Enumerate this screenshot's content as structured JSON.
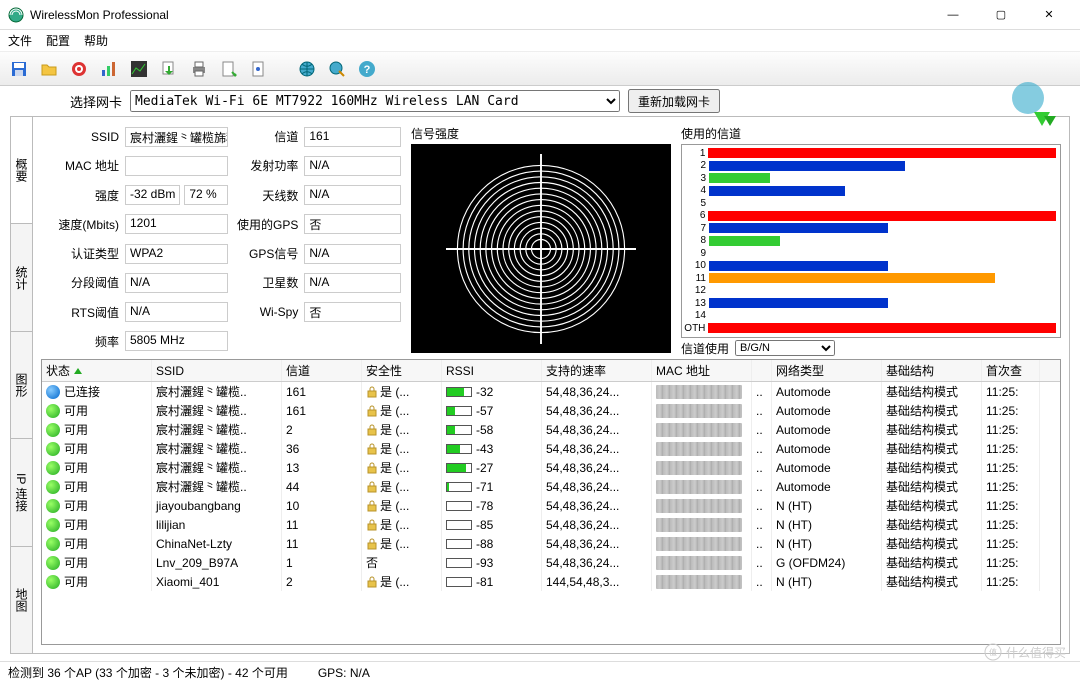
{
  "window": {
    "title": "WirelessMon Professional"
  },
  "menu": {
    "file": "文件",
    "config": "配置",
    "help": "帮助"
  },
  "selector": {
    "label": "选择网卡",
    "card": "MediaTek Wi-Fi 6E MT7922 160MHz Wireless LAN Card",
    "reload": "重新加载网卡"
  },
  "tabs": {
    "t0": "概要",
    "t1": "统计",
    "t2": "图形",
    "t3": "IP 连接",
    "t4": "地图"
  },
  "info": {
    "ssid_l": "SSID",
    "ssid": "宸村灑鍟⺀罐榄旆稃wh",
    "mac_l": "MAC 地址",
    "mac": "",
    "str_l": "强度",
    "str": "-32 dBm",
    "str_pct": "72 %",
    "speed_l": "速度(Mbits)",
    "speed": "1201",
    "auth_l": "认证类型",
    "auth": "WPA2",
    "frag_l": "分段阈值",
    "frag": "N/A",
    "rts_l": "RTS阈值",
    "rts": "N/A",
    "freq_l": "频率",
    "freq": "5805 MHz",
    "chan_l": "信道",
    "chan": "161",
    "tx_l": "发射功率",
    "tx": "N/A",
    "ant_l": "天线数",
    "ant": "N/A",
    "gps_l": "使用的GPS",
    "gps": "否",
    "gpssig_l": "GPS信号",
    "gpssig": "N/A",
    "sat_l": "卫星数",
    "sat": "N/A",
    "wispy_l": "Wi-Spy",
    "wispy": "否"
  },
  "gauge_hdr": "信号强度",
  "chan_hdr": "使用的信道",
  "chan_sel_l": "信道使用",
  "chan_sel_v": "B/G/N",
  "chart_data": {
    "type": "bar",
    "title": "使用的信道",
    "categories": [
      "1",
      "2",
      "3",
      "4",
      "5",
      "6",
      "7",
      "8",
      "9",
      "10",
      "11",
      "12",
      "13",
      "14",
      "OTH"
    ],
    "bars": [
      {
        "ch": "1",
        "color": "red",
        "pct": 100
      },
      {
        "ch": "2",
        "color": "blue",
        "pct": 55
      },
      {
        "ch": "3",
        "color": "green",
        "pct": 17
      },
      {
        "ch": "4",
        "color": "blue",
        "pct": 38
      },
      {
        "ch": "5",
        "color": "",
        "pct": 0
      },
      {
        "ch": "6",
        "color": "red",
        "pct": 100
      },
      {
        "ch": "7",
        "color": "blue",
        "pct": 50
      },
      {
        "ch": "8",
        "color": "green",
        "pct": 20
      },
      {
        "ch": "9",
        "color": "",
        "pct": 0
      },
      {
        "ch": "10",
        "color": "blue",
        "pct": 50
      },
      {
        "ch": "11",
        "color": "orange",
        "pct": 80
      },
      {
        "ch": "12",
        "color": "",
        "pct": 0
      },
      {
        "ch": "13",
        "color": "blue",
        "pct": 50
      },
      {
        "ch": "14",
        "color": "",
        "pct": 0
      },
      {
        "ch": "OTH",
        "color": "red",
        "pct": 100
      }
    ]
  },
  "cols": {
    "status": "状态",
    "ssid": "SSID",
    "chan": "信道",
    "sec": "安全性",
    "rssi": "RSSI",
    "rate": "支持的速率",
    "mac": "MAC 地址",
    "net": "网络类型",
    "infra": "基础结构",
    "first": "首次查"
  },
  "rows": [
    {
      "st": "conn",
      "st_l": "已连接",
      "ssid": "宸村灑鍟⺀罐榄..",
      "ch": "161",
      "sec": "是 (...",
      "rssi": -32,
      "fill": 72,
      "rate": "54,48,36,24...",
      "mac": "",
      "dots": "..",
      "net": "Automode",
      "infra": "基础结构模式",
      "first": "11:25:"
    },
    {
      "st": "avail",
      "st_l": "可用",
      "ssid": "宸村灑鍟⺀罐榄..",
      "ch": "161",
      "sec": "是 (...",
      "rssi": -57,
      "fill": 35,
      "rate": "54,48,36,24...",
      "mac": "",
      "dots": "..",
      "net": "Automode",
      "infra": "基础结构模式",
      "first": "11:25:"
    },
    {
      "st": "avail",
      "st_l": "可用",
      "ssid": "宸村灑鍟⺀罐榄..",
      "ch": "2",
      "sec": "是 (...",
      "rssi": -58,
      "fill": 33,
      "rate": "54,48,36,24...",
      "mac": "",
      "dots": "..",
      "net": "Automode",
      "infra": "基础结构模式",
      "first": "11:25:"
    },
    {
      "st": "avail",
      "st_l": "可用",
      "ssid": "宸村灑鍟⺀罐榄..",
      "ch": "36",
      "sec": "是 (...",
      "rssi": -43,
      "fill": 55,
      "rate": "54,48,36,24...",
      "mac": "",
      "dots": "..",
      "net": "Automode",
      "infra": "基础结构模式",
      "first": "11:25:"
    },
    {
      "st": "avail",
      "st_l": "可用",
      "ssid": "宸村灑鍟⺀罐榄..",
      "ch": "13",
      "sec": "是 (...",
      "rssi": -27,
      "fill": 78,
      "rate": "54,48,36,24...",
      "mac": "",
      "dots": "..",
      "net": "Automode",
      "infra": "基础结构模式",
      "first": "11:25:"
    },
    {
      "st": "avail",
      "st_l": "可用",
      "ssid": "宸村灑鍟⺀罐榄..",
      "ch": "44",
      "sec": "是 (...",
      "rssi": -71,
      "fill": 10,
      "rate": "54,48,36,24...",
      "mac": "",
      "dots": "..",
      "net": "Automode",
      "infra": "基础结构模式",
      "first": "11:25:"
    },
    {
      "st": "avail",
      "st_l": "可用",
      "ssid": "jiayoubangbang",
      "ch": "10",
      "sec": "是 (...",
      "rssi": -78,
      "fill": 3,
      "rate": "54,48,36,24...",
      "mac": "",
      "dots": "..",
      "net": "N (HT)",
      "infra": "基础结构模式",
      "first": "11:25:"
    },
    {
      "st": "avail",
      "st_l": "可用",
      "ssid": "lilijian",
      "ch": "11",
      "sec": "是 (...",
      "rssi": -85,
      "fill": 0,
      "rate": "54,48,36,24...",
      "mac": "",
      "dots": "..",
      "net": "N (HT)",
      "infra": "基础结构模式",
      "first": "11:25:"
    },
    {
      "st": "avail",
      "st_l": "可用",
      "ssid": "ChinaNet-Lzty",
      "ch": "11",
      "sec": "是 (...",
      "rssi": -88,
      "fill": 0,
      "rate": "54,48,36,24...",
      "mac": "",
      "dots": "..",
      "net": "N (HT)",
      "infra": "基础结构模式",
      "first": "11:25:"
    },
    {
      "st": "avail",
      "st_l": "可用",
      "ssid": "Lnv_209_B97A",
      "ch": "1",
      "sec": "否",
      "rssi": -93,
      "fill": 0,
      "rate": "54,48,36,24...",
      "mac": "",
      "dots": "..",
      "net": "G (OFDM24)",
      "infra": "基础结构模式",
      "first": "11:25:"
    },
    {
      "st": "avail",
      "st_l": "可用",
      "ssid": "Xiaomi_401",
      "ch": "2",
      "sec": "是 (...",
      "rssi": -81,
      "fill": 0,
      "rate": "144,54,48,3...",
      "mac": "",
      "dots": "..",
      "net": "N (HT)",
      "infra": "基础结构模式",
      "first": "11:25:"
    }
  ],
  "status": {
    "left": "检测到 36 个AP (33 个加密 - 3 个未加密) - 42 个可用",
    "gps": "GPS: N/A"
  },
  "watermark": "什么值得买"
}
